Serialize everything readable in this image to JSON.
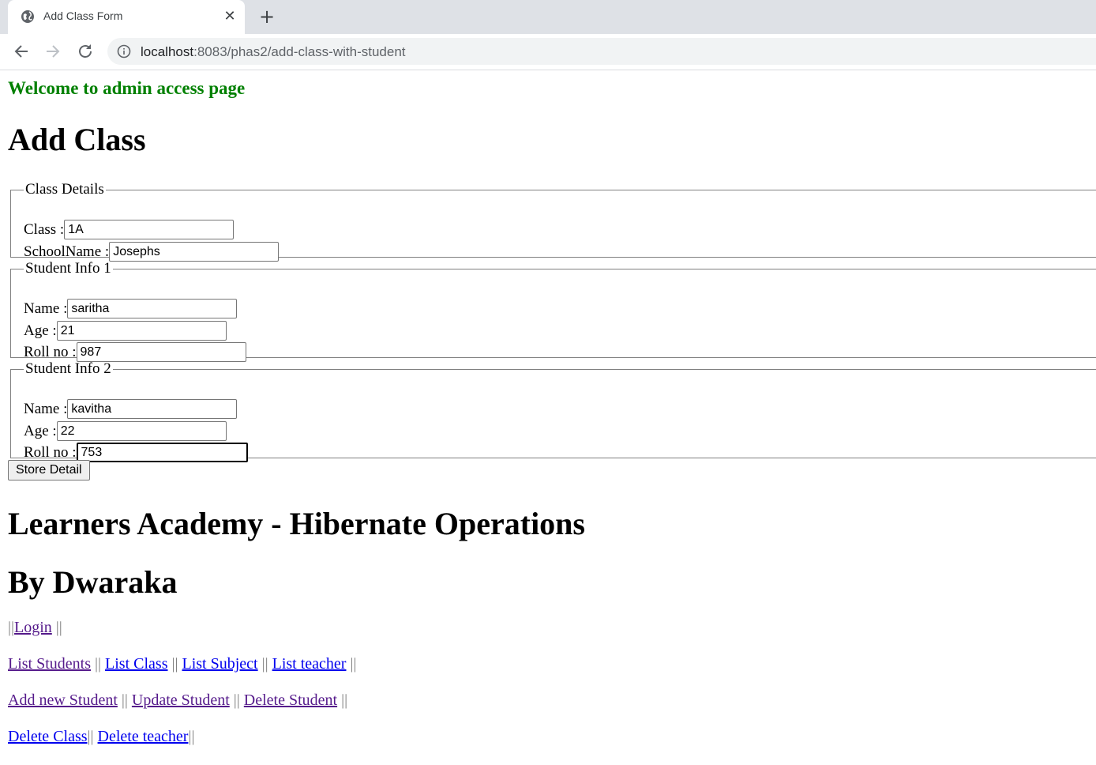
{
  "browser": {
    "tab_title": "Add Class Form",
    "url_host": "localhost",
    "url_rest": ":8083/phas2/add-class-with-student"
  },
  "page": {
    "welcome": "Welcome to admin access page",
    "heading": "Add Class",
    "class_details": {
      "legend": "Class Details",
      "class_label": "Class :",
      "class_value": "1A",
      "school_label": "SchoolName :",
      "school_value": "Josephs"
    },
    "student1": {
      "legend": "Student Info 1",
      "name_label": "Name :",
      "name_value": "saritha",
      "age_label": "Age :",
      "age_value": "21",
      "roll_label": "Roll no :",
      "roll_value": "987"
    },
    "student2": {
      "legend": "Student Info 2",
      "name_label": "Name :",
      "name_value": "kavitha",
      "age_label": "Age :",
      "age_value": "22",
      "roll_label": "Roll no :",
      "roll_value": "753"
    },
    "submit_label": "Store Detail",
    "title1": "Learners Academy - Hibernate Operations",
    "title2": "By Dwaraka",
    "nav": {
      "sep": "||",
      "login": "Login",
      "list_students": "List Students",
      "list_class": "List Class",
      "list_subject": "List Subject",
      "list_teacher": "List teacher",
      "add_student": "Add new Student",
      "update_student": "Update Student",
      "delete_student": "Delete Student",
      "delete_class": "Delete Class",
      "delete_teacher": "Delete teacher"
    }
  }
}
